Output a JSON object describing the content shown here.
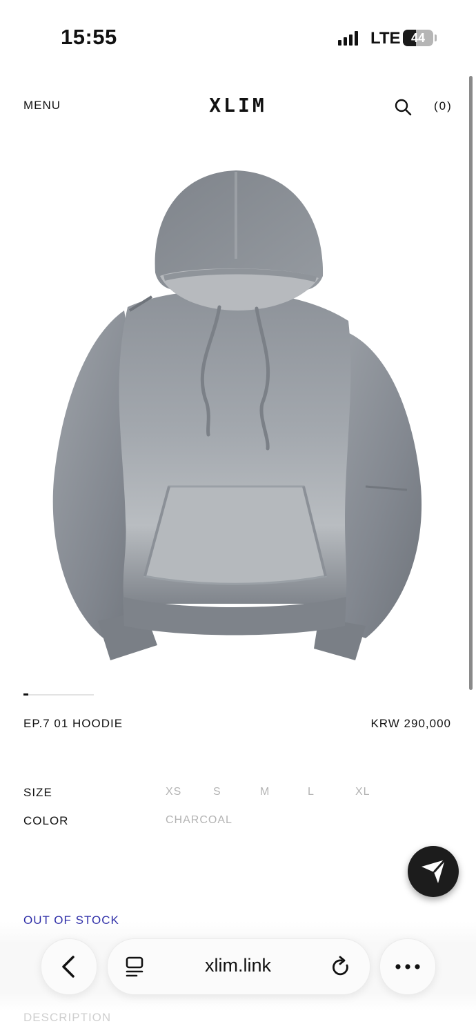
{
  "status_bar": {
    "time": "15:55",
    "network": "LTE",
    "battery_level": "44",
    "battery_fraction": 0.44
  },
  "header": {
    "menu_label": "MENU",
    "brand": "XLIM",
    "cart_count": "(0)"
  },
  "gallery": {
    "current_index": 1,
    "image_alt": "Grey washed hoodie"
  },
  "product": {
    "name": "EP.7 01 HOODIE",
    "price": "KRW 290,000",
    "size_label": "SIZE",
    "sizes": [
      "XS",
      "S",
      "M",
      "L",
      "XL"
    ],
    "color_label": "COLOR",
    "color_value": "CHARCOAL",
    "stock_status": "OUT OF STOCK",
    "description_label": "DESCRIPTION"
  },
  "browser": {
    "url": "xlim.link"
  },
  "colors": {
    "accent_stock": "#2b2ba6",
    "disabled_option": "#b3b3b3",
    "fab_background": "#1c1c1c"
  }
}
